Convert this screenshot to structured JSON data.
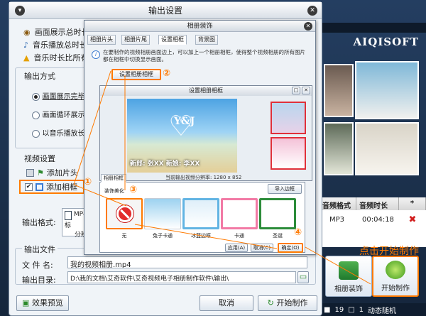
{
  "background_app": {
    "brand": "AIQISOFT",
    "thumbnails": [
      "photo",
      "photo",
      "photo",
      "photo",
      "photo",
      "photo",
      "photo"
    ],
    "table": {
      "headers": [
        "音频格式",
        "音频时长",
        "*"
      ],
      "row": {
        "format": "MP3",
        "duration": "00:04:18"
      }
    },
    "hint": "点击开始制作",
    "buttons": {
      "album_decor": "相册装饰",
      "start": "开始制作"
    },
    "status": {
      "count": "19",
      "pages": "1",
      "mode": "动态随机"
    }
  },
  "main_dialog": {
    "title": "输出设置",
    "top_options": [
      "画面展示总时长",
      "音乐播放总时长",
      "音乐时长比所有"
    ],
    "output_mode": {
      "title": "输出方式",
      "options": [
        "画面展示完毕",
        "画面循环展示",
        "以音乐播放长度为"
      ]
    },
    "video_settings": {
      "title": "视频设置",
      "add_header": "添加片头",
      "add_frame": "添加相框"
    },
    "output_format": {
      "label": "输出格式:",
      "value_line1": "MP4 - 标",
      "value_line2": "分辨率"
    },
    "output_file": {
      "title": "输出文件",
      "filename_label": "文 件 名:",
      "filename": "我的视频相册.mp4",
      "dir_label": "输出目录:",
      "dir": "D:\\我的文档\\艾奇软件\\艾奇视频电子相册制作软件\\输出\\"
    },
    "buttons": {
      "preview": "效果预览",
      "cancel": "取消",
      "start": "开始制作"
    }
  },
  "album_dialog": {
    "title": "相册装饰",
    "tabs": [
      "相册片头",
      "相册片尾",
      "设置相框",
      "背景图"
    ],
    "info": "在要制作的视频相册画面边上，可以加上一个相册相框，使得整个视频相册的所有图片都在相框中切换显示画面。",
    "set_frame_button": "设置相册相框"
  },
  "preview_dialog": {
    "title": "设置相册相框",
    "photo_text": "Y&J",
    "names": "新郎: 张XX   新娘: 李XX",
    "frames_tab": "相册相框",
    "frames_header": "装饰美化",
    "import_button": "导入边框",
    "resolution": "当前输出视频分辨率: 1280 x 852",
    "frames": [
      "无",
      "兔子卡通",
      "冰蓝边框",
      "卡通",
      "圣诞"
    ],
    "buttons": {
      "apply": "应用(A)",
      "cancel": "取消(C)",
      "ok": "确定(O)"
    }
  },
  "annotations": [
    "①",
    "②",
    "③",
    "④"
  ]
}
